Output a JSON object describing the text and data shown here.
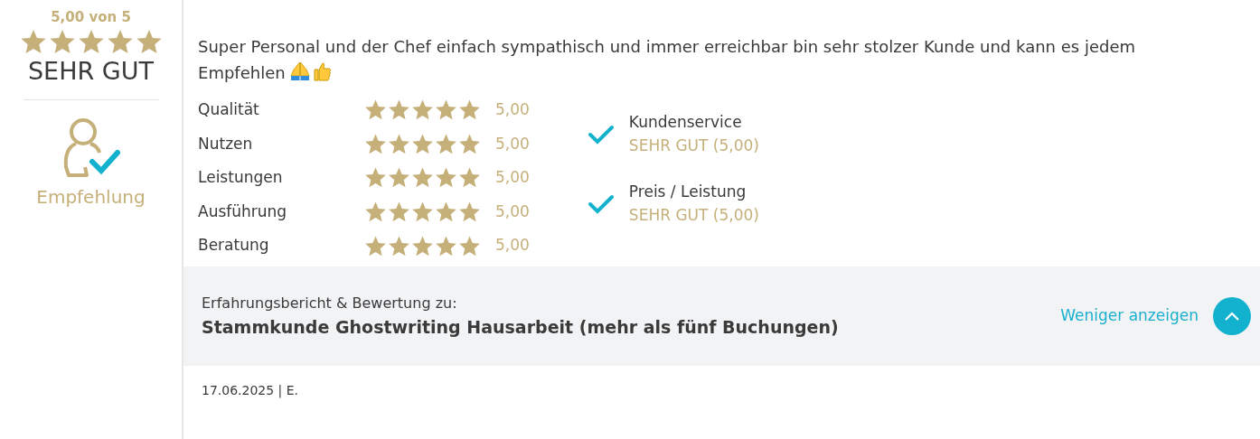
{
  "summary": {
    "score": "5,00 von 5",
    "stars": 5,
    "verdict": "SEHR GUT",
    "recommendation": "Empfehlung"
  },
  "review": {
    "text": "Super Personal und der Chef einfach sympathisch und immer erreichbar bin sehr stolzer Kunde und kann es jedem Empfehlen 🙏 👍"
  },
  "criteria": [
    {
      "label": "Qualität",
      "stars": 5,
      "value": "5,00"
    },
    {
      "label": "Nutzen",
      "stars": 5,
      "value": "5,00"
    },
    {
      "label": "Leistungen",
      "stars": 5,
      "value": "5,00"
    },
    {
      "label": "Ausführung",
      "stars": 5,
      "value": "5,00"
    },
    {
      "label": "Beratung",
      "stars": 5,
      "value": "5,00"
    }
  ],
  "highlights": [
    {
      "label": "Kundenservice",
      "rating": "SEHR GUT (5,00)"
    },
    {
      "label": "Preis / Leistung",
      "rating": "SEHR GUT (5,00)"
    }
  ],
  "footer": {
    "caption": "Erfahrungsbericht & Bewertung zu:",
    "title": "Stammkunde Ghostwriting Hausarbeit (mehr als fünf Buchungen)",
    "toggle": "Weniger anzeigen",
    "expanded": true
  },
  "meta": "17.06.2025 | E."
}
